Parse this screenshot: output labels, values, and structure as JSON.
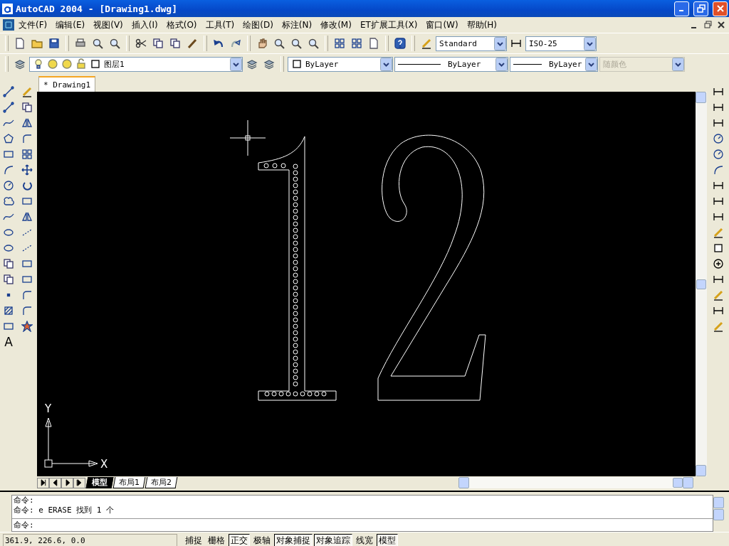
{
  "window": {
    "title": "AutoCAD 2004 - [Drawing1.dwg]"
  },
  "menu": [
    {
      "label": "文件(F)"
    },
    {
      "label": "编辑(E)"
    },
    {
      "label": "视图(V)"
    },
    {
      "label": "插入(I)"
    },
    {
      "label": "格式(O)"
    },
    {
      "label": "工具(T)"
    },
    {
      "label": "绘图(D)"
    },
    {
      "label": "标注(N)"
    },
    {
      "label": "修改(M)"
    },
    {
      "label": "ET扩展工具(X)"
    },
    {
      "label": "窗口(W)"
    },
    {
      "label": "帮助(H)"
    }
  ],
  "styles_toolbar": {
    "text_style": "Standard",
    "dimension_style": "ISO-25"
  },
  "layers_toolbar": {
    "layer": "图层1"
  },
  "properties_toolbar": {
    "color_setting": "ByLayer",
    "linetype": "ByLayer",
    "lineweight": "ByLayer",
    "plot_style": {
      "value": "随颜色",
      "disabled": true
    }
  },
  "draw_toolbar": {
    "text_tool_glyph": "A"
  },
  "document_tab": {
    "label": "* Drawing1"
  },
  "canvas": {
    "axis_x": "X",
    "axis_y": "Y"
  },
  "layout_tabs": [
    {
      "label": "模型",
      "selected": true
    },
    {
      "label": "布局1",
      "selected": false
    },
    {
      "label": "布局2",
      "selected": false
    }
  ],
  "command_window": {
    "history": [
      "命令:",
      "命令: e ERASE 找到 1 个"
    ],
    "prompt": "命令:"
  },
  "status_bar": {
    "coordinates": "361.9, 226.6, 0.0",
    "toggles": [
      {
        "label": "捕捉",
        "on": false
      },
      {
        "label": "栅格",
        "on": false
      },
      {
        "label": "正交",
        "on": true
      },
      {
        "label": "极轴",
        "on": false
      },
      {
        "label": "对象捕捉",
        "on": true
      },
      {
        "label": "对象追踪",
        "on": true
      },
      {
        "label": "线宽",
        "on": false
      },
      {
        "label": "模型",
        "on": true
      }
    ]
  }
}
